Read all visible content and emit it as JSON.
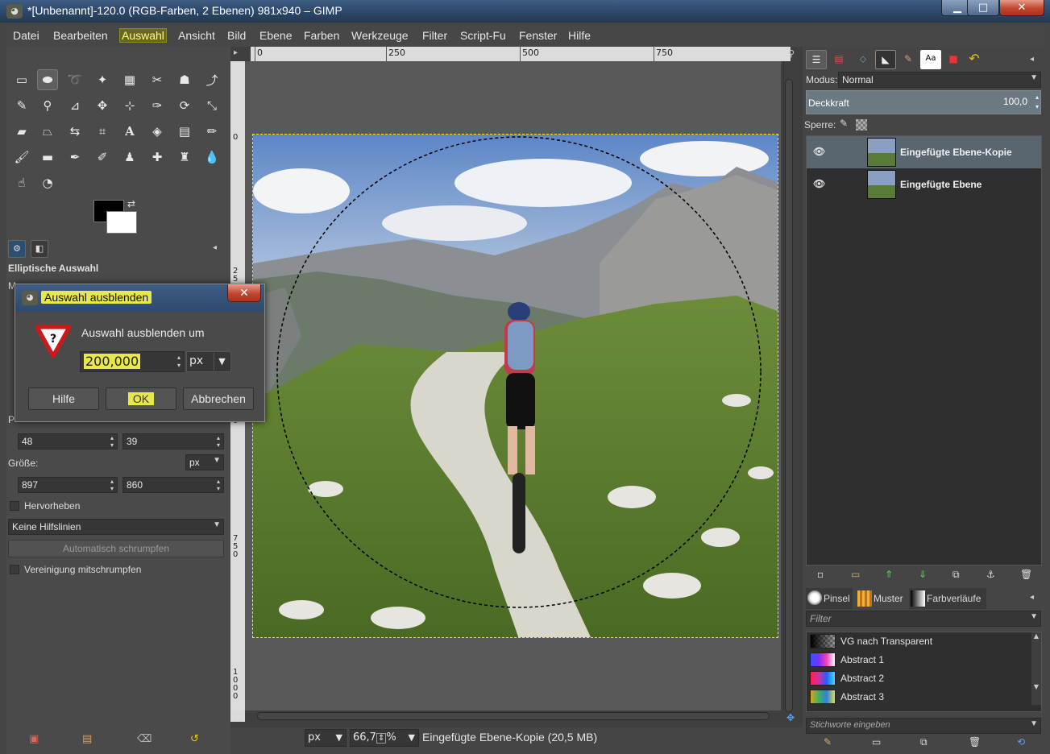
{
  "window": {
    "title": "*[Unbenannt]-120.0 (RGB-Farben, 2 Ebenen) 981x940 – GIMP",
    "minimize": "▁",
    "maximize": "□",
    "close": "✕"
  },
  "menu": [
    "Datei",
    "Bearbeiten",
    "Auswahl",
    "Ansicht",
    "Bild",
    "Ebene",
    "Farben",
    "Werkzeuge",
    "Filter",
    "Script-Fu",
    "Fenster",
    "Hilfe"
  ],
  "toolbox": {
    "tools": [
      "rect-select",
      "ellipse-select",
      "free-select",
      "fuzzy-select",
      "color-select",
      "scissors-select",
      "foreground-select",
      "paths",
      "color-picker",
      "zoom",
      "measure",
      "move",
      "align",
      "crop",
      "rotate",
      "scale",
      "shear",
      "perspective",
      "flip",
      "cage",
      "text",
      "bucket-fill",
      "blend",
      "pencil",
      "paintbrush",
      "eraser",
      "airbrush",
      "ink",
      "clone",
      "heal",
      "perspective-clone",
      "blur",
      "smudge",
      "dodge-burn"
    ],
    "options_title": "Elliptische Auswahl",
    "pos_x": "48",
    "pos_y": "39",
    "size_label": "Größe:",
    "size_unit": "px",
    "size_w": "897",
    "size_h": "860",
    "highlight_label": "Hervorheben",
    "guides_value": "Keine Hilfslinien",
    "autoshrink_label": "Automatisch schrumpfen",
    "shrink_merged_label": "Vereinigung mitschrumpfen",
    "partial_label_m": "M",
    "partial_label_p": "P"
  },
  "canvas": {
    "ruler_h": [
      "0",
      "250",
      "500",
      "750"
    ],
    "ruler_v": [
      "0",
      "250",
      "500",
      "750",
      "1000"
    ],
    "unit": "px",
    "zoom": "66,7",
    "zoom_suffix": "%",
    "status": "Eingefügte Ebene-Kopie (20,5 MB)"
  },
  "layers": {
    "mode_label": "Modus:",
    "mode_value": "Normal",
    "opacity_label": "Deckkraft",
    "opacity_value": "100,0",
    "lock_label": "Sperre:",
    "items": [
      {
        "name": "Eingefügte Ebene-Kopie",
        "selected": true
      },
      {
        "name": "Eingefügte Ebene",
        "selected": false
      }
    ]
  },
  "brushes": {
    "tabs": [
      "Pinsel",
      "Muster",
      "Farbverläufe"
    ],
    "filter_placeholder": "Filter",
    "gradients": [
      {
        "name": "VG nach Transparent"
      },
      {
        "name": "Abstract 1"
      },
      {
        "name": "Abstract 2"
      },
      {
        "name": "Abstract 3"
      }
    ],
    "tags_placeholder": "Stichworte eingeben"
  },
  "dialog": {
    "title": "Auswahl ausblenden",
    "prompt": "Auswahl ausblenden um",
    "value": "200,000",
    "unit": "px",
    "help": "Hilfe",
    "ok": "OK",
    "cancel": "Abbrechen"
  }
}
